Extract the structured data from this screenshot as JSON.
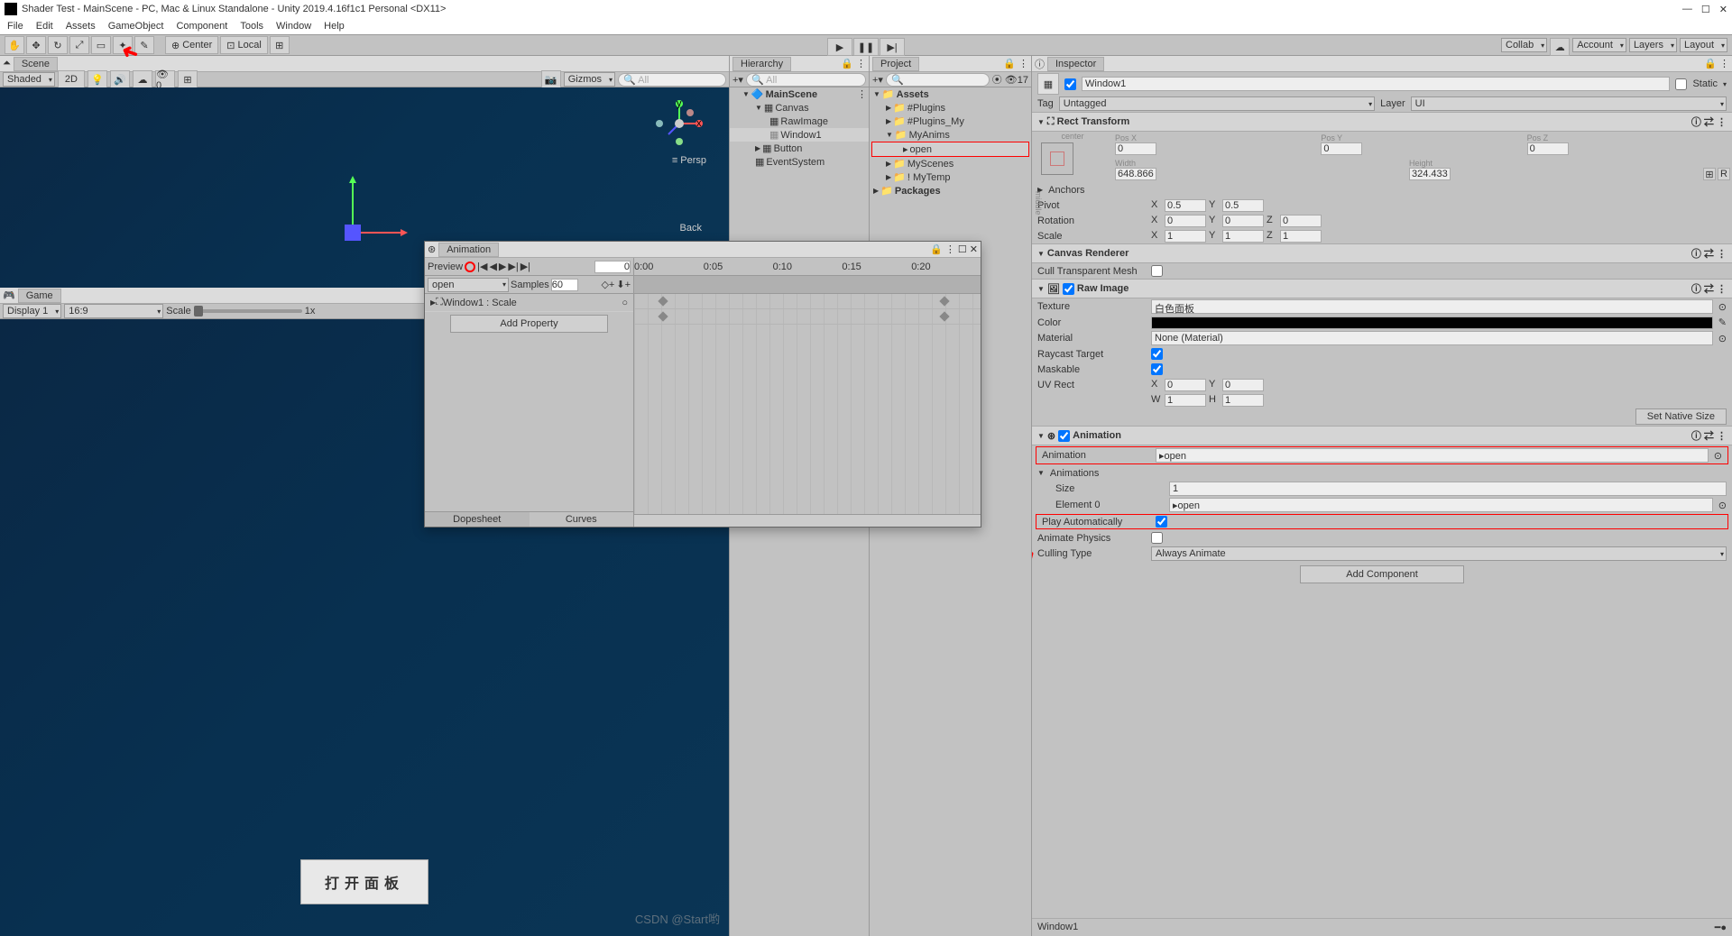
{
  "title": "Shader Test - MainScene - PC, Mac & Linux Standalone - Unity 2019.4.16f1c1 Personal <DX11>",
  "menu": [
    "File",
    "Edit",
    "Assets",
    "GameObject",
    "Component",
    "Tools",
    "Window",
    "Help"
  ],
  "toolbar": {
    "center": "Center",
    "local": "Local",
    "collab": "Collab",
    "account": "Account",
    "layers": "Layers",
    "layout": "Layout"
  },
  "scene": {
    "tab": "Scene",
    "shaded": "Shaded",
    "mode": "2D",
    "gizmos": "Gizmos",
    "search": "All",
    "persp": "Persp",
    "back": "Back"
  },
  "game": {
    "tab": "Game",
    "display": "Display 1",
    "aspect": "16:9",
    "scale": "Scale",
    "scaleVal": "1x",
    "button": "打开面板"
  },
  "hierarchy": {
    "tab": "Hierarchy",
    "search": "All",
    "scene": "MainScene",
    "items": [
      "Canvas",
      "RawImage",
      "Window1",
      "Button",
      "EventSystem"
    ]
  },
  "project": {
    "tab": "Project",
    "search": "",
    "count": "17",
    "assets": "Assets",
    "folders": [
      "#Plugins",
      "#Plugins_My",
      "MyAnims"
    ],
    "file": "open",
    "folders2": [
      "MyScenes",
      "!  MyTemp"
    ],
    "packages": "Packages"
  },
  "animation": {
    "tab": "Animation",
    "preview": "Preview",
    "clip": "open",
    "samples": "Samples",
    "samplesVal": "60",
    "frame": "0",
    "prop": "Window1 : Scale",
    "addProp": "Add Property",
    "times": [
      "0:00",
      "0:05",
      "0:10",
      "0:15",
      "0:20"
    ],
    "dopesheet": "Dopesheet",
    "curves": "Curves"
  },
  "inspector": {
    "tab": "Inspector",
    "name": "Window1",
    "static": "Static",
    "tag": "Tag",
    "tagVal": "Untagged",
    "layer": "Layer",
    "layerVal": "UI",
    "rect": {
      "title": "Rect Transform",
      "center": "center",
      "middle": "middle",
      "posX": "Pos X",
      "posXV": "0",
      "posY": "Pos Y",
      "posYV": "0",
      "posZ": "Pos Z",
      "posZV": "0",
      "width": "Width",
      "widthV": "648.866",
      "height": "Height",
      "heightV": "324.433",
      "anchors": "Anchors",
      "pivot": "Pivot",
      "pivotX": "0.5",
      "pivotY": "0.5",
      "rotation": "Rotation",
      "rotX": "0",
      "rotY": "0",
      "rotZ": "0",
      "scale": "Scale",
      "scaleX": "1",
      "scaleY": "1",
      "scaleZ": "1",
      "r": "R"
    },
    "canvas": {
      "title": "Canvas Renderer",
      "cull": "Cull Transparent Mesh"
    },
    "rawImage": {
      "title": "Raw Image",
      "texture": "Texture",
      "textureV": "白色面板",
      "color": "Color",
      "material": "Material",
      "materialV": "None (Material)",
      "raycast": "Raycast Target",
      "maskable": "Maskable",
      "uvrect": "UV Rect",
      "x": "0",
      "y": "0",
      "w": "1",
      "h": "1",
      "setNative": "Set Native Size"
    },
    "anim": {
      "title": "Animation",
      "animation": "Animation",
      "animationV": "open",
      "animations": "Animations",
      "size": "Size",
      "sizeV": "1",
      "elem0": "Element 0",
      "elem0V": "open",
      "playAuto": "Play Automatically",
      "animPhys": "Animate Physics",
      "culling": "Culling Type",
      "cullingV": "Always Animate"
    },
    "addComp": "Add Component",
    "footer": "Window1"
  },
  "watermark": "CSDN @Start哟"
}
